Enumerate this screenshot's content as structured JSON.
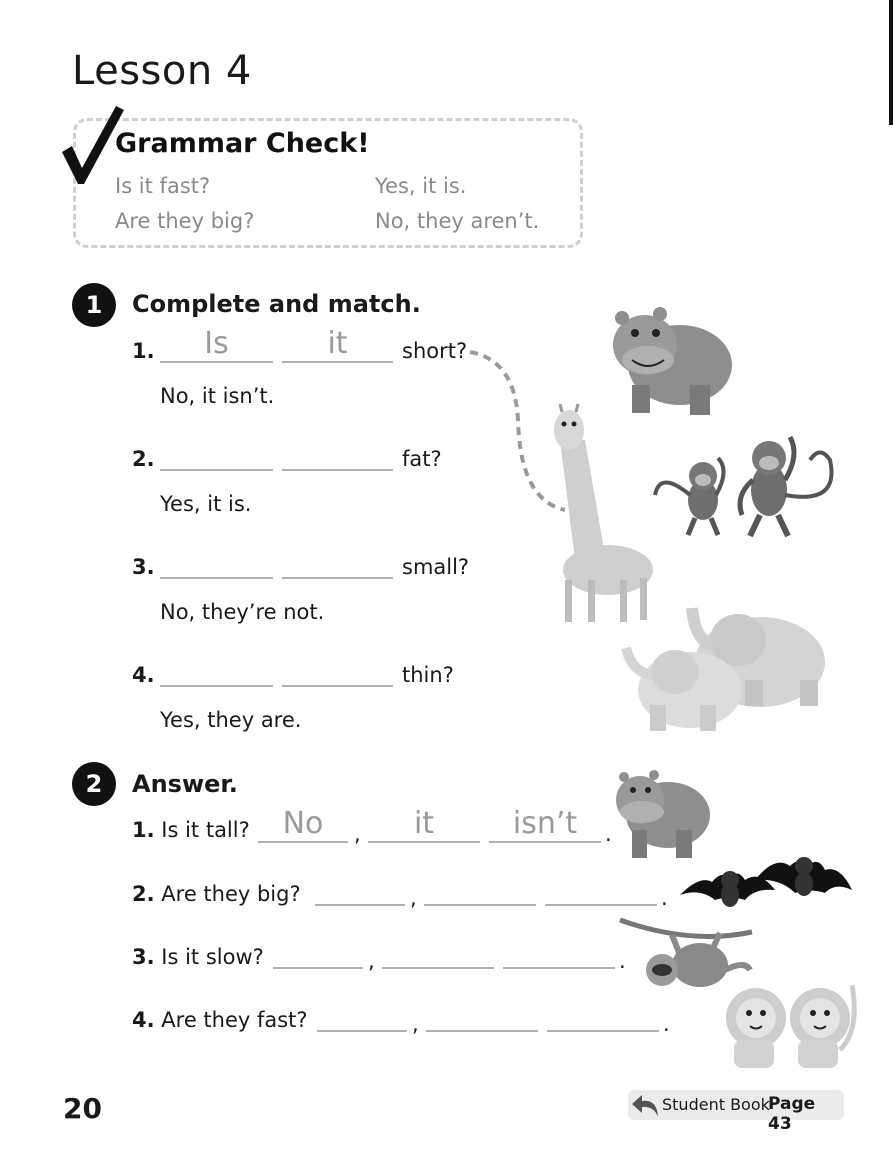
{
  "lesson_title": "Lesson 4",
  "grammar": {
    "title": "Grammar Check!",
    "rows": [
      {
        "q": "Is it fast?",
        "a": "Yes, it is."
      },
      {
        "q": "Are they big?",
        "a": "No, they aren’t."
      }
    ]
  },
  "ex1": {
    "number": "1",
    "title": "Complete and match.",
    "items": [
      {
        "n": "1.",
        "w1": "Is",
        "w2": "it",
        "end": "short?",
        "answer": "No, it isn’t."
      },
      {
        "n": "2.",
        "w1": "",
        "w2": "",
        "end": "fat?",
        "answer": "Yes, it is."
      },
      {
        "n": "3.",
        "w1": "",
        "w2": "",
        "end": "small?",
        "answer": "No, they’re not."
      },
      {
        "n": "4.",
        "w1": "",
        "w2": "",
        "end": "thin?",
        "answer": "Yes, they are."
      }
    ]
  },
  "ex2": {
    "number": "2",
    "title": "Answer.",
    "items": [
      {
        "n": "1.",
        "q": "Is it tall?",
        "a1": "No",
        "a2": "it",
        "a3": "isn’t",
        "comma": ",",
        "period": "."
      },
      {
        "n": "2.",
        "q": "Are they big?",
        "a1": "",
        "a2": "",
        "a3": "",
        "comma": ",",
        "period": "."
      },
      {
        "n": "3.",
        "q": "Is it slow?",
        "a1": "",
        "a2": "",
        "a3": "",
        "comma": ",",
        "period": "."
      },
      {
        "n": "4.",
        "q": "Are they fast?",
        "a1": "",
        "a2": "",
        "a3": "",
        "comma": ",",
        "period": "."
      }
    ]
  },
  "page_number": "20",
  "student_book": {
    "label": "Student Book",
    "page": "Page 43"
  }
}
